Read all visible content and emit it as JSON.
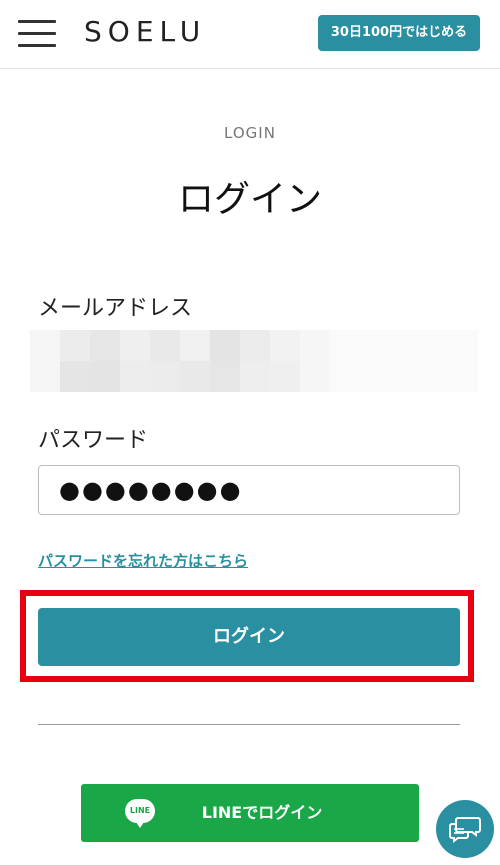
{
  "header": {
    "logo": "SOELU",
    "trial_button": "30日100円ではじめる",
    "menu_icon": "hamburger-menu-icon"
  },
  "main": {
    "eyebrow": "LOGIN",
    "title": "ログイン",
    "email_label": "メールアドレス",
    "password_label": "パスワード",
    "password_value": "●●●●●●●●",
    "forgot_link": "パスワードを忘れた方はこちら",
    "login_button": "ログイン",
    "line_icon_text": "LINE",
    "line_button": "LINEでログイン"
  },
  "floating": {
    "chat_icon": "chat-bubbles-icon"
  },
  "colors": {
    "accent": "#2a8fa0",
    "highlight": "#e60012",
    "line_green": "#1aa748"
  }
}
